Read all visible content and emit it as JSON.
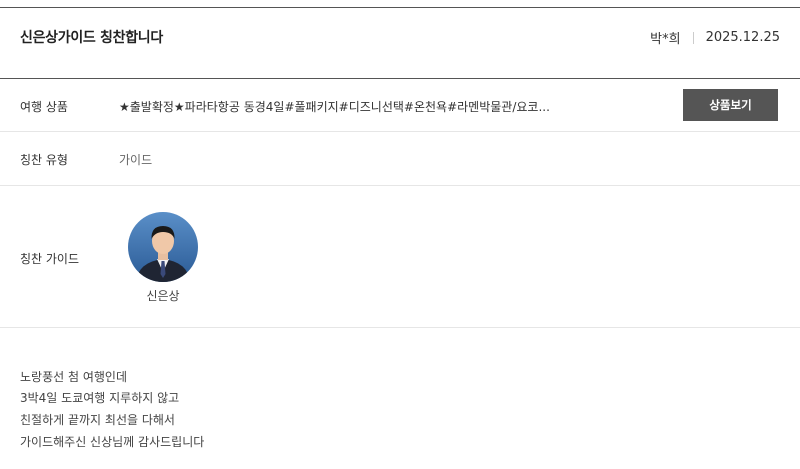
{
  "review": {
    "title": "신은상가이드 칭찬합니다",
    "author": "박*희",
    "date": "2025.12.25"
  },
  "product": {
    "label": "여행 상품",
    "name": "★출발확정★파라타항공 동경4일#풀패키지#디즈니선택#온천욕#라멘박물관/요코...",
    "button_label": "상품보기"
  },
  "praise_type": {
    "label": "칭찬 유형",
    "value": "가이드"
  },
  "guide": {
    "label": "칭찬 가이드",
    "name": "신은상",
    "avatar_icon": "guide-portrait-icon"
  },
  "content": {
    "lines": [
      "노랑풍선 첨 여행인데",
      "3박4일 도쿄여행 지루하지 않고",
      "친절하게 끝까지 최선을 다해서",
      "가이드해주신 신상님께 감사드립니다"
    ]
  },
  "colors": {
    "button_bg": "#555555",
    "divider": "#e6e6e6"
  }
}
